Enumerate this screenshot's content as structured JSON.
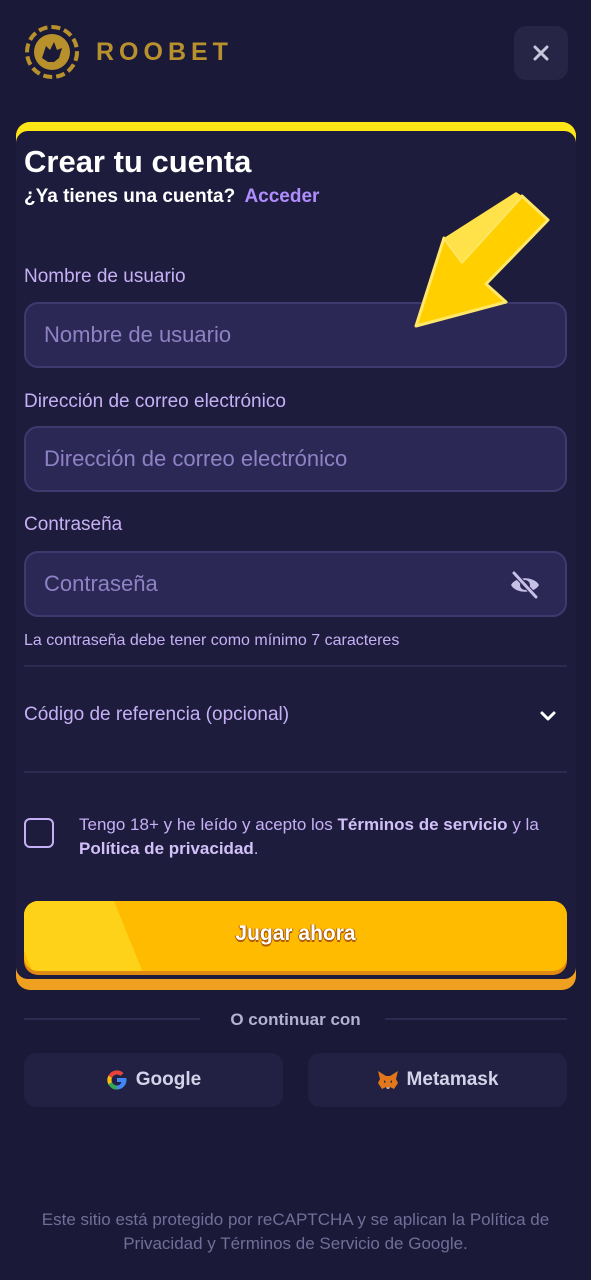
{
  "header": {
    "brand": "ROOBET",
    "close_label": "×"
  },
  "form": {
    "title": "Crear tu cuenta",
    "have_account_text": "¿Ya tienes una cuenta?",
    "login_link": "Acceder",
    "username": {
      "label": "Nombre de usuario",
      "placeholder": "Nombre de usuario",
      "value": ""
    },
    "email": {
      "label": "Dirección de correo electrónico",
      "placeholder": "Dirección de correo electrónico",
      "value": ""
    },
    "password": {
      "label": "Contraseña",
      "placeholder": "Contraseña",
      "value": ""
    },
    "password_hint": "La contraseña debe tener como mínimo 7 caracteres",
    "referral_label": "Código de referencia (opcional)",
    "terms": {
      "prefix": "Tengo 18+ y he leído y acepto los",
      "tos": "Términos de servicio",
      "middle": "y la",
      "privacy": "Política de privacidad",
      "suffix": ".",
      "checked": false
    },
    "submit_label": "Jugar ahora"
  },
  "alt_login": {
    "divider_text": "O continuar con",
    "google_label": "Google",
    "metamask_label": "Metamask"
  },
  "footer_text": "Este sitio está protegido por reCAPTCHA y se aplican la Política de Privacidad y Términos de Servicio de Google.",
  "colors": {
    "background": "#1a1938",
    "accent_purple": "#b08dff",
    "button_yellow": "#ffbb00",
    "card_top_yellow": "#ffe516"
  },
  "icons": [
    "roobet-logo-icon",
    "close-icon",
    "eye-off-icon",
    "chevron-down-icon",
    "google-icon",
    "metamask-icon",
    "arrow-pointer-icon"
  ]
}
